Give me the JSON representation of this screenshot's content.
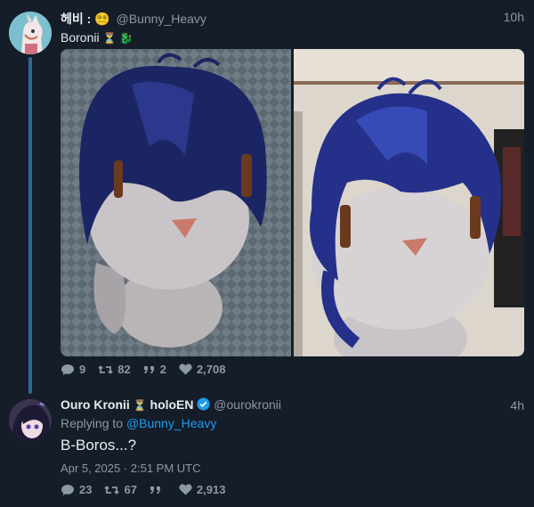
{
  "tweet1": {
    "author_name": "헤비 :",
    "author_emoji": "😵‍💫",
    "handle": "@Bunny_Heavy",
    "time": "10h",
    "text": "Boronii",
    "text_emojis": [
      "⏳",
      "🐉"
    ],
    "stats": {
      "replies": "9",
      "retweets": "82",
      "quotes": "2",
      "likes": "2,708"
    }
  },
  "tweet2": {
    "author_name": "Ouro Kronii",
    "name_suffix": "holoEN",
    "handle": "@ourokronii",
    "time": "4h",
    "replying_label": "Replying to",
    "replying_handle": "@Bunny_Heavy",
    "text": "B-Boros...?",
    "date": "Apr 5, 2025 · 2:51 PM UTC",
    "stats": {
      "replies": "23",
      "retweets": "67",
      "quotes": "",
      "likes": "2,913"
    }
  },
  "icons": [
    "reply-icon",
    "retweet-icon",
    "quote-icon",
    "like-icon",
    "verified-icon",
    "hourglass-icon"
  ],
  "colors": {
    "background": "#151d28",
    "link": "#1d9bf0",
    "muted": "#8b98a5",
    "thread": "#2d6894"
  }
}
